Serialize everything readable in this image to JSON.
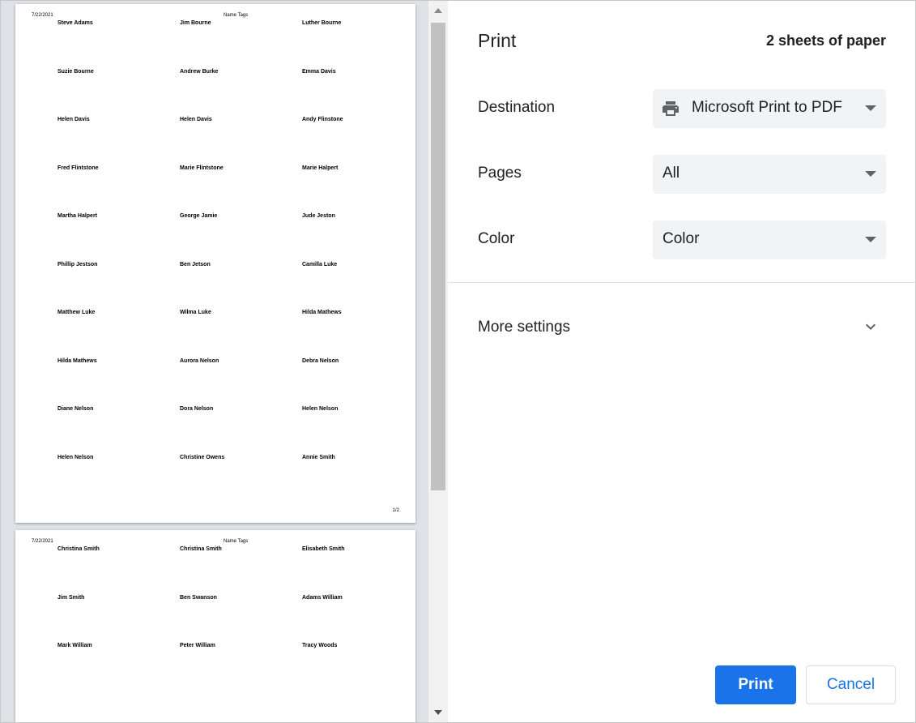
{
  "preview": {
    "pages": [
      {
        "date": "7/22/2021",
        "title": "Name Tags",
        "page_number": "1/2",
        "tags": [
          [
            "Steve Adams",
            "Jim Bourne",
            "Luther Bourne"
          ],
          [
            "Suzie Bourne",
            "Andrew Burke",
            "Emma Davis"
          ],
          [
            "Helen Davis",
            "Helen Davis",
            "Andy Flinstone"
          ],
          [
            "Fred Flintstone",
            "Marie Flintstone",
            "Marie Halpert"
          ],
          [
            "Martha Halpert",
            "George Jamie",
            "Jude Jeston"
          ],
          [
            "Phillip Jestson",
            "Ben Jetson",
            "Camilla Luke"
          ],
          [
            "Matthew Luke",
            "Wilma Luke",
            "Hilda Mathews"
          ],
          [
            "Hilda Mathews",
            "Aurora Nelson",
            "Debra Nelson"
          ],
          [
            "Diane Nelson",
            "Dora Nelson",
            "Helen Nelson"
          ],
          [
            "Helen Nelson",
            "Christine Owens",
            "Annie Smith"
          ]
        ]
      },
      {
        "date": "7/22/2021",
        "title": "Name Tags",
        "tags": [
          [
            "Christina Smith",
            "Christina Smith",
            "Elisabeth Smith"
          ],
          [
            "Jim Smith",
            "Ben Swanson",
            "Adams William"
          ],
          [
            "Mark William",
            "Peter William",
            "Tracy Woods"
          ]
        ]
      }
    ]
  },
  "settings": {
    "title": "Print",
    "sheets_count": "2 sheets of paper",
    "destination": {
      "label": "Destination",
      "value": "Microsoft Print to PDF",
      "icon": "printer-icon"
    },
    "pages": {
      "label": "Pages",
      "value": "All"
    },
    "color": {
      "label": "Color",
      "value": "Color"
    },
    "more_settings": {
      "label": "More settings",
      "icon": "chevron-down-icon"
    },
    "buttons": {
      "print": "Print",
      "cancel": "Cancel"
    }
  },
  "colors": {
    "accent": "#1a73e8",
    "dropdown_bg": "#f1f3f4",
    "preview_bg": "#dee1e6"
  }
}
